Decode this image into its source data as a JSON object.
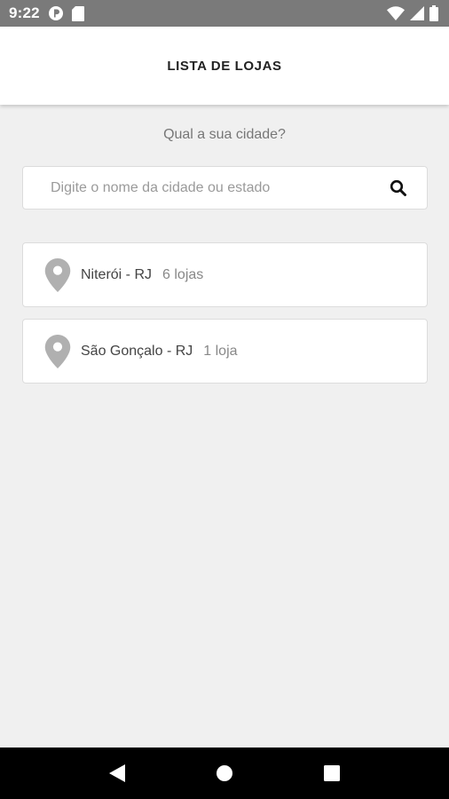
{
  "status_bar": {
    "time": "9:22",
    "icons": [
      "app-notification-icon",
      "sd-card-icon",
      "wifi-icon",
      "signal-icon",
      "battery-icon"
    ]
  },
  "app_bar": {
    "title": "LISTA DE LOJAS"
  },
  "main": {
    "question": "Qual a sua cidade?",
    "search": {
      "placeholder": "Digite o nome da cidade ou estado",
      "value": ""
    },
    "cities": [
      {
        "name": "Niterói - RJ",
        "count": "6 lojas"
      },
      {
        "name": "São Gonçalo - RJ",
        "count": "1 loja"
      }
    ]
  },
  "nav_bar": {
    "buttons": [
      "back-icon",
      "home-icon",
      "recents-icon"
    ]
  },
  "colors": {
    "status_bar": "#7a7a7a",
    "background": "#f0f0f0",
    "pin": "#b0b0b0",
    "nav_bar": "#000000"
  }
}
